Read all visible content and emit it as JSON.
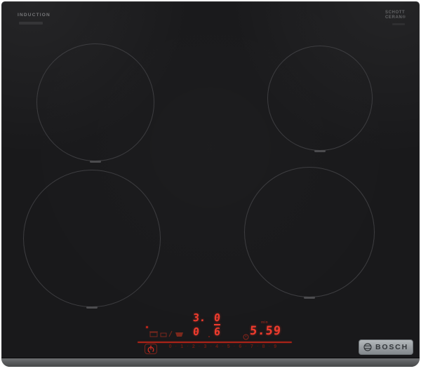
{
  "branding": {
    "induction_label": "INDUCTION",
    "schott": {
      "line1": "SCHOTT",
      "line2": "CERAN®"
    },
    "bosch_label": "BOSCH"
  },
  "controls": {
    "zone_displays": {
      "back_left": "3.",
      "back_right": "0",
      "front_left": "0",
      "front_right": "6"
    },
    "front_right_timer_bar": true,
    "timer": {
      "value": "5.59",
      "unit": "min"
    },
    "power_slider": {
      "levels": [
        "0",
        "1",
        "2",
        "3",
        "4",
        "5",
        "6",
        "7",
        "8",
        "9"
      ]
    },
    "icons": {
      "status_dot": "red-indicator-dot",
      "function_row": [
        "pot-icon",
        "pause-icon",
        "divider-slash",
        "keep-warm-icon"
      ],
      "timer": "timer-clock-icon",
      "power": "power-icon"
    }
  },
  "colors": {
    "led_red": "#ef3b2d",
    "dim_red": "#6b1b12",
    "glass_black": "#19191b",
    "badge_gray": "#9aa0a4",
    "ring_gray": "#3d3d40"
  }
}
